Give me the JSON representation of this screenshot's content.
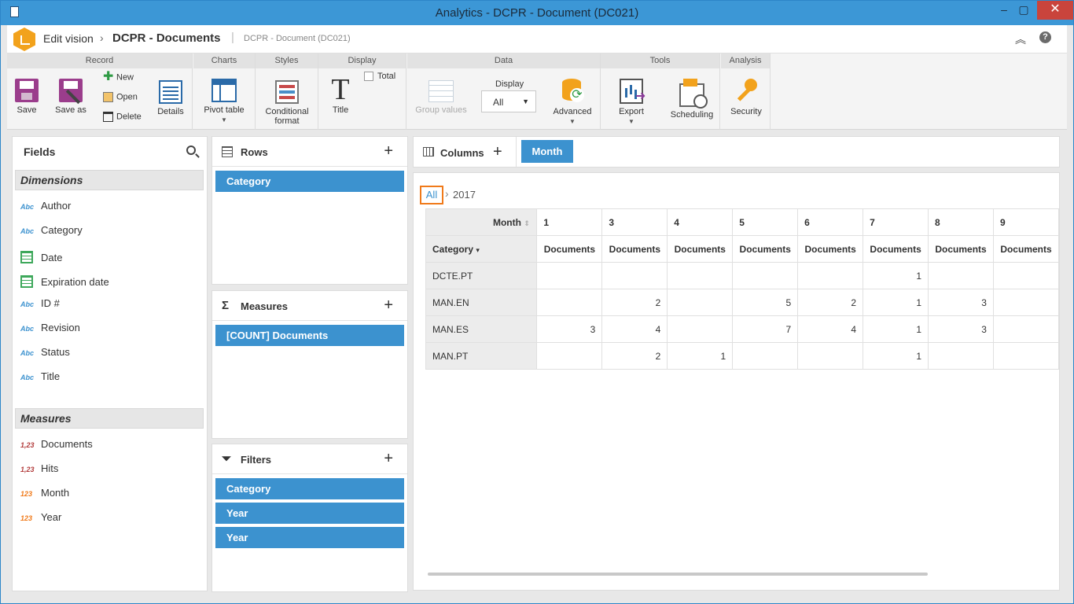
{
  "window": {
    "title": "Analytics - DCPR - Document (DC021)"
  },
  "appbar": {
    "crumb1": "Edit vision",
    "crumb_sep": "›",
    "crumb2": "DCPR - Documents",
    "crumb3": "DCPR - Document (DC021)",
    "help": "?"
  },
  "ribbon": {
    "groups": {
      "record": "Record",
      "charts": "Charts",
      "styles": "Styles",
      "display": "Display",
      "data": "Data",
      "tools": "Tools",
      "analysis": "Analysis"
    },
    "save": "Save",
    "save_as": "Save as",
    "new": "New",
    "open": "Open",
    "delete": "Delete",
    "details": "Details",
    "pivot_table": "Pivot table",
    "conditional_format_1": "Conditional",
    "conditional_format_2": "format",
    "title": "Title",
    "title_glyph": "T",
    "total": "Total",
    "group_values": "Group values",
    "display_label": "Display",
    "display_value": "All",
    "advanced": "Advanced",
    "export": "Export",
    "scheduling": "Scheduling",
    "security": "Security"
  },
  "fields": {
    "title": "Fields",
    "dimensions_label": "Dimensions",
    "dimensions": [
      {
        "type": "Abc",
        "label": "Author"
      },
      {
        "type": "Abc",
        "label": "Category"
      },
      {
        "type": "date",
        "label": "Date"
      },
      {
        "type": "date",
        "label": "Expiration date"
      },
      {
        "type": "Abc",
        "label": "ID #"
      },
      {
        "type": "Abc",
        "label": "Revision"
      },
      {
        "type": "Abc",
        "label": "Status"
      },
      {
        "type": "Abc",
        "label": "Title"
      }
    ],
    "measures_label": "Measures",
    "measures": [
      {
        "type": "1,23",
        "label": "Documents"
      },
      {
        "type": "1,23",
        "label": "Hits"
      },
      {
        "type": "123",
        "label": "Month"
      },
      {
        "type": "123",
        "label": "Year"
      }
    ]
  },
  "rows_panel": {
    "title": "Rows",
    "chips": [
      "Category"
    ]
  },
  "measures_panel": {
    "title": "Measures",
    "icon": "Σ",
    "chips": [
      "[COUNT] Documents"
    ]
  },
  "filters_panel": {
    "title": "Filters",
    "chips": [
      "Category",
      "Year",
      "Year"
    ]
  },
  "columns_bar": {
    "title": "Columns",
    "chips": [
      "Month"
    ]
  },
  "grid": {
    "breadcrumb": {
      "all": "All",
      "sep": "›",
      "year": "2017"
    },
    "month_header": "Month",
    "category_header": "Category",
    "months": [
      "1",
      "3",
      "4",
      "5",
      "6",
      "7",
      "8",
      "9"
    ],
    "measure_label": "Documents",
    "rows": [
      {
        "category": "DCTE.PT",
        "values": [
          "",
          "",
          "",
          "",
          "",
          "1",
          "",
          ""
        ]
      },
      {
        "category": "MAN.EN",
        "values": [
          "",
          "2",
          "",
          "5",
          "2",
          "1",
          "3",
          ""
        ]
      },
      {
        "category": "MAN.ES",
        "values": [
          "3",
          "4",
          "",
          "7",
          "4",
          "1",
          "3",
          ""
        ]
      },
      {
        "category": "MAN.PT",
        "values": [
          "",
          "2",
          "1",
          "",
          "",
          "1",
          "",
          ""
        ]
      }
    ]
  }
}
